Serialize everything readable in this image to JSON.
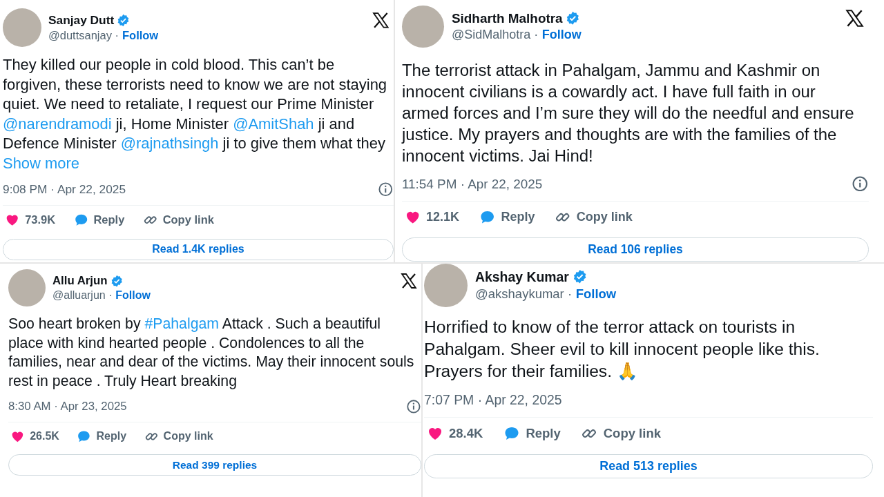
{
  "tweets": [
    {
      "name": "Sanjay Dutt",
      "verified": true,
      "handle": "@duttsanjay ·",
      "follow": "Follow",
      "x_logo": true,
      "text": [
        {
          "kind": "plain",
          "text": "They killed our people in cold blood. This can’t be forgiven, these terrorists need to know we are not staying quiet. We need to retaliate, I request our Prime Minister "
        },
        {
          "kind": "mention",
          "text": "@narendramodi"
        },
        {
          "kind": "plain",
          "text": " ji, Home Minister "
        },
        {
          "kind": "mention",
          "text": "@AmitShah"
        },
        {
          "kind": "plain",
          "text": " ji and Defence Minister "
        },
        {
          "kind": "mention",
          "text": "@rajnathsingh"
        },
        {
          "kind": "plain",
          "text": " ji to give them what they "
        },
        {
          "kind": "more",
          "text": "Show more"
        }
      ],
      "time": "9:08 PM · Apr 22, 2025",
      "info": true,
      "likes": "73.9K",
      "reply": "Reply",
      "copy": "Copy link",
      "read": "Read 1.4K replies"
    },
    {
      "name": "Sidharth Malhotra",
      "verified": true,
      "handle": "@SidMalhotra ·",
      "follow": "Follow",
      "x_logo": true,
      "text": [
        {
          "kind": "plain",
          "text": "The terrorist attack in Pahalgam, Jammu and Kashmir on innocent civilians is a cowardly act. I have full faith in our armed forces and I’m sure they will do the needful and ensure justice. My prayers and thoughts are with the families of the innocent victims. Jai Hind!"
        }
      ],
      "time": "11:54 PM · Apr 22, 2025",
      "info": true,
      "likes": "12.1K",
      "reply": "Reply",
      "copy": "Copy link",
      "read": "Read 106 replies"
    },
    {
      "name": "Allu Arjun",
      "verified": true,
      "handle": "@alluarjun ·",
      "follow": "Follow",
      "x_logo": true,
      "text": [
        {
          "kind": "plain",
          "text": "Soo heart broken by "
        },
        {
          "kind": "mention",
          "text": "#Pahalgam"
        },
        {
          "kind": "plain",
          "text": " Attack . Such a beautiful place with kind hearted people . Condolences to all the families, near and dear of the victims. May their innocent souls rest in peace . Truly Heart breaking"
        }
      ],
      "time": "8:30 AM · Apr 23, 2025",
      "info": true,
      "likes": "26.5K",
      "reply": "Reply",
      "copy": "Copy link",
      "read": "Read 399 replies"
    },
    {
      "name": "Akshay Kumar",
      "verified": true,
      "handle": "@akshaykumar ·",
      "follow": "Follow",
      "text": [
        {
          "kind": "plain",
          "text": "Horrified to know of the terror attack on tourists in Pahalgam. Sheer evil to kill innocent people like this. Prayers for their families. 🙏"
        }
      ],
      "time": "7:07 PM · Apr 22, 2025",
      "likes": "28.4K",
      "reply": "Reply",
      "copy": "Copy link",
      "read": "Read 513 replies"
    }
  ]
}
